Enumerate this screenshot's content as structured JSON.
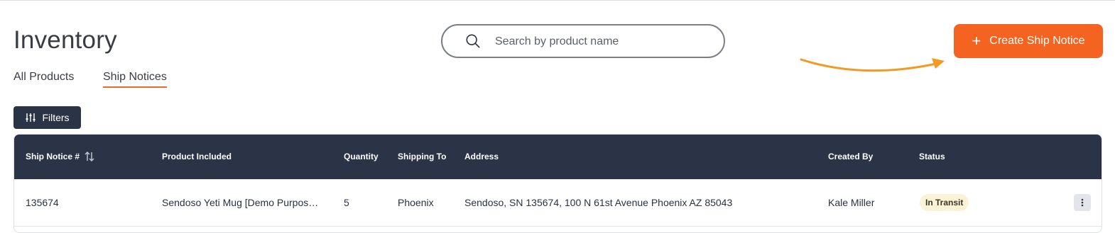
{
  "page": {
    "title": "Inventory"
  },
  "tabs": [
    {
      "label": "All Products",
      "active": false
    },
    {
      "label": "Ship Notices",
      "active": true
    }
  ],
  "search": {
    "placeholder": "Search by product name",
    "value": ""
  },
  "actions": {
    "create_label": "Create Ship Notice",
    "filters_label": "Filters"
  },
  "colors": {
    "accent": "#f4631f",
    "header_bg": "#2b3447",
    "status_bg": "#fbf3d6",
    "arrow": "#f39a25"
  },
  "icons": {
    "search": "search-icon",
    "plus": "plus-icon",
    "filters": "sliders-icon",
    "sort": "sort-arrows-icon",
    "more": "kebab-menu-icon",
    "pointer": "curved-arrow-icon"
  },
  "table": {
    "columns": [
      "Ship Notice #",
      "Product Included",
      "Quantity",
      "Shipping To",
      "Address",
      "Created By",
      "Status"
    ],
    "rows": [
      {
        "ship_notice": "135674",
        "product": "Sendoso Yeti Mug [Demo Purposes Only]",
        "quantity": "5",
        "shipping_to": "Phoenix",
        "address": "Sendoso, SN 135674, 100 N 61st Avenue Phoenix AZ 85043",
        "created_by": "Kale Miller",
        "status": "In Transit"
      }
    ]
  }
}
